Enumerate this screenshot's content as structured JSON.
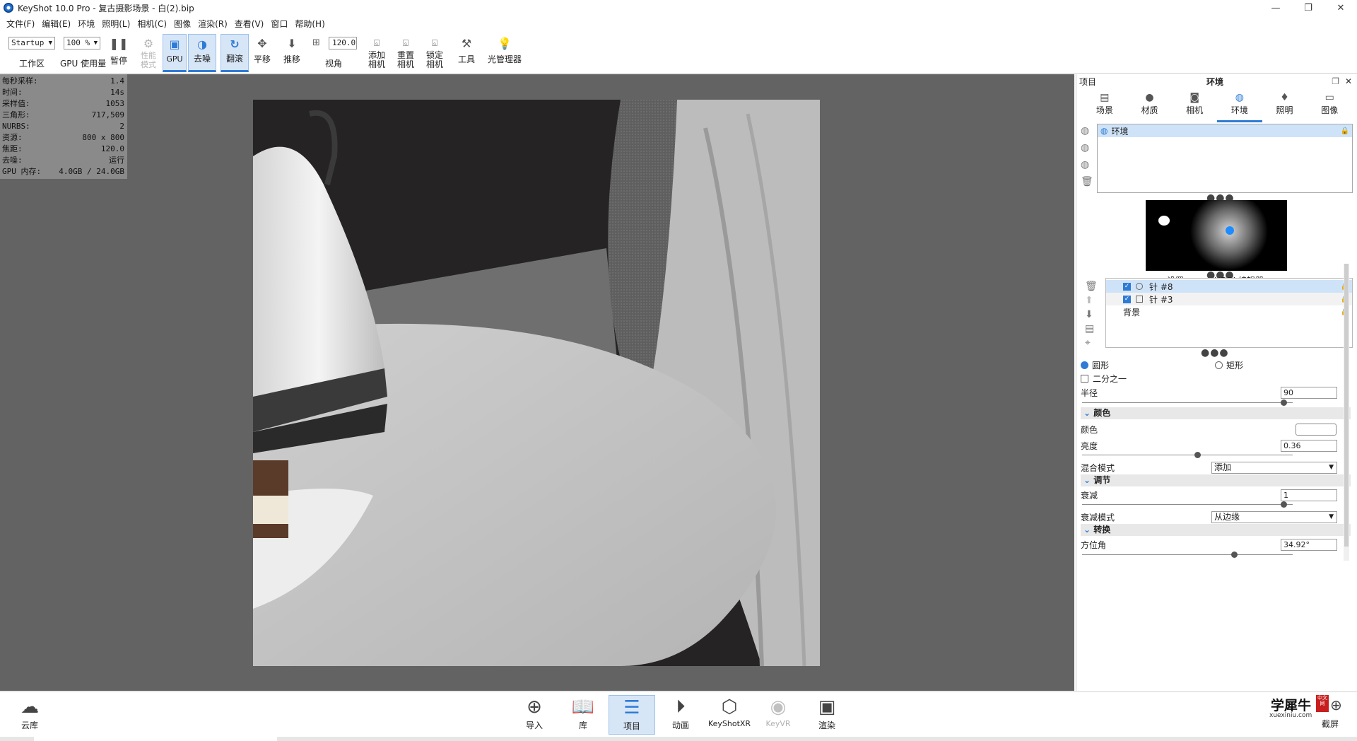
{
  "window": {
    "title": "KeyShot 10.0 Pro  - 复古摄影场景 - 白(2).bip",
    "controls": [
      "—",
      "❐",
      "✕"
    ]
  },
  "menu": [
    "文件(F)",
    "编辑(E)",
    "环境",
    "照明(L)",
    "相机(C)",
    "图像",
    "渲染(R)",
    "查看(V)",
    "窗口",
    "帮助(H)"
  ],
  "toolbar": {
    "workspace_value": "Startup",
    "workspace_label": "工作区",
    "gpu_usage_value": "100 %",
    "gpu_usage_label": "GPU 使用量",
    "pause": "暂停",
    "perf_mode": "性能\n模式",
    "gpu": "GPU",
    "denoise": "去噪",
    "tumble": "翻滚",
    "pan": "平移",
    "dolly": "推移",
    "fov_value": "120.0",
    "fov_label": "视角",
    "add_camera": "添加\n相机",
    "reset_camera": "重置\n相机",
    "lock_camera": "锁定\n相机",
    "tools": "工具",
    "light_manager": "光管理器"
  },
  "stats": [
    {
      "k": "每秒采样:",
      "v": "1.4"
    },
    {
      "k": "时间:",
      "v": "14s"
    },
    {
      "k": "采样值:",
      "v": "1053"
    },
    {
      "k": "三角形:",
      "v": "717,509"
    },
    {
      "k": "NURBS:",
      "v": "2"
    },
    {
      "k": "资源:",
      "v": "800 x 800"
    },
    {
      "k": "焦距:",
      "v": "120.0"
    },
    {
      "k": "去噪:",
      "v": "运行"
    },
    {
      "k": "GPU 内存:",
      "v": "4.0GB / 24.0GB"
    }
  ],
  "panel": {
    "left_title": "项目",
    "center_title": "环境",
    "tabs": [
      {
        "label": "场景",
        "icon": "scene-icon"
      },
      {
        "label": "材质",
        "icon": "material-icon"
      },
      {
        "label": "相机",
        "icon": "camera-icon"
      },
      {
        "label": "环境",
        "icon": "environment-icon"
      },
      {
        "label": "照明",
        "icon": "lighting-icon"
      },
      {
        "label": "图像",
        "icon": "image-icon"
      }
    ],
    "env_item": "环境",
    "subtabs": [
      "设置",
      "HDRI 编辑器"
    ],
    "pins": [
      {
        "label": "针 #8",
        "checked": true,
        "selected": true
      },
      {
        "label": "针 #3",
        "checked": true,
        "selected": false
      },
      {
        "label": "背景",
        "checked": false,
        "selected": false
      }
    ],
    "shape_circle": "圆形",
    "shape_rect": "矩形",
    "half": "二分之一",
    "radius_label": "半径",
    "radius_value": "90",
    "color_section": "颜色",
    "color_label": "颜色",
    "brightness_label": "亮度",
    "brightness_value": "0.36",
    "blend_label": "混合模式",
    "blend_value": "添加",
    "adjust_section": "调节",
    "falloff_label": "衰减",
    "falloff_value": "1",
    "falloff_mode_label": "衰减模式",
    "falloff_mode_value": "从边缘",
    "transform_section": "转换",
    "azimuth_label": "方位角",
    "azimuth_value": "34.92°",
    "colors": {
      "accent": "#2e7bd6",
      "selection": "#cfe3f8"
    }
  },
  "dock": {
    "cloud": "云库",
    "items": [
      "导入",
      "库",
      "项目",
      "动画",
      "KeyShotXR",
      "KeyVR",
      "渲染"
    ],
    "screenshot": "截屏",
    "watermark_cn": "学犀牛",
    "watermark_url": "xuexiniu.com",
    "watermark_badge": "中文网"
  }
}
